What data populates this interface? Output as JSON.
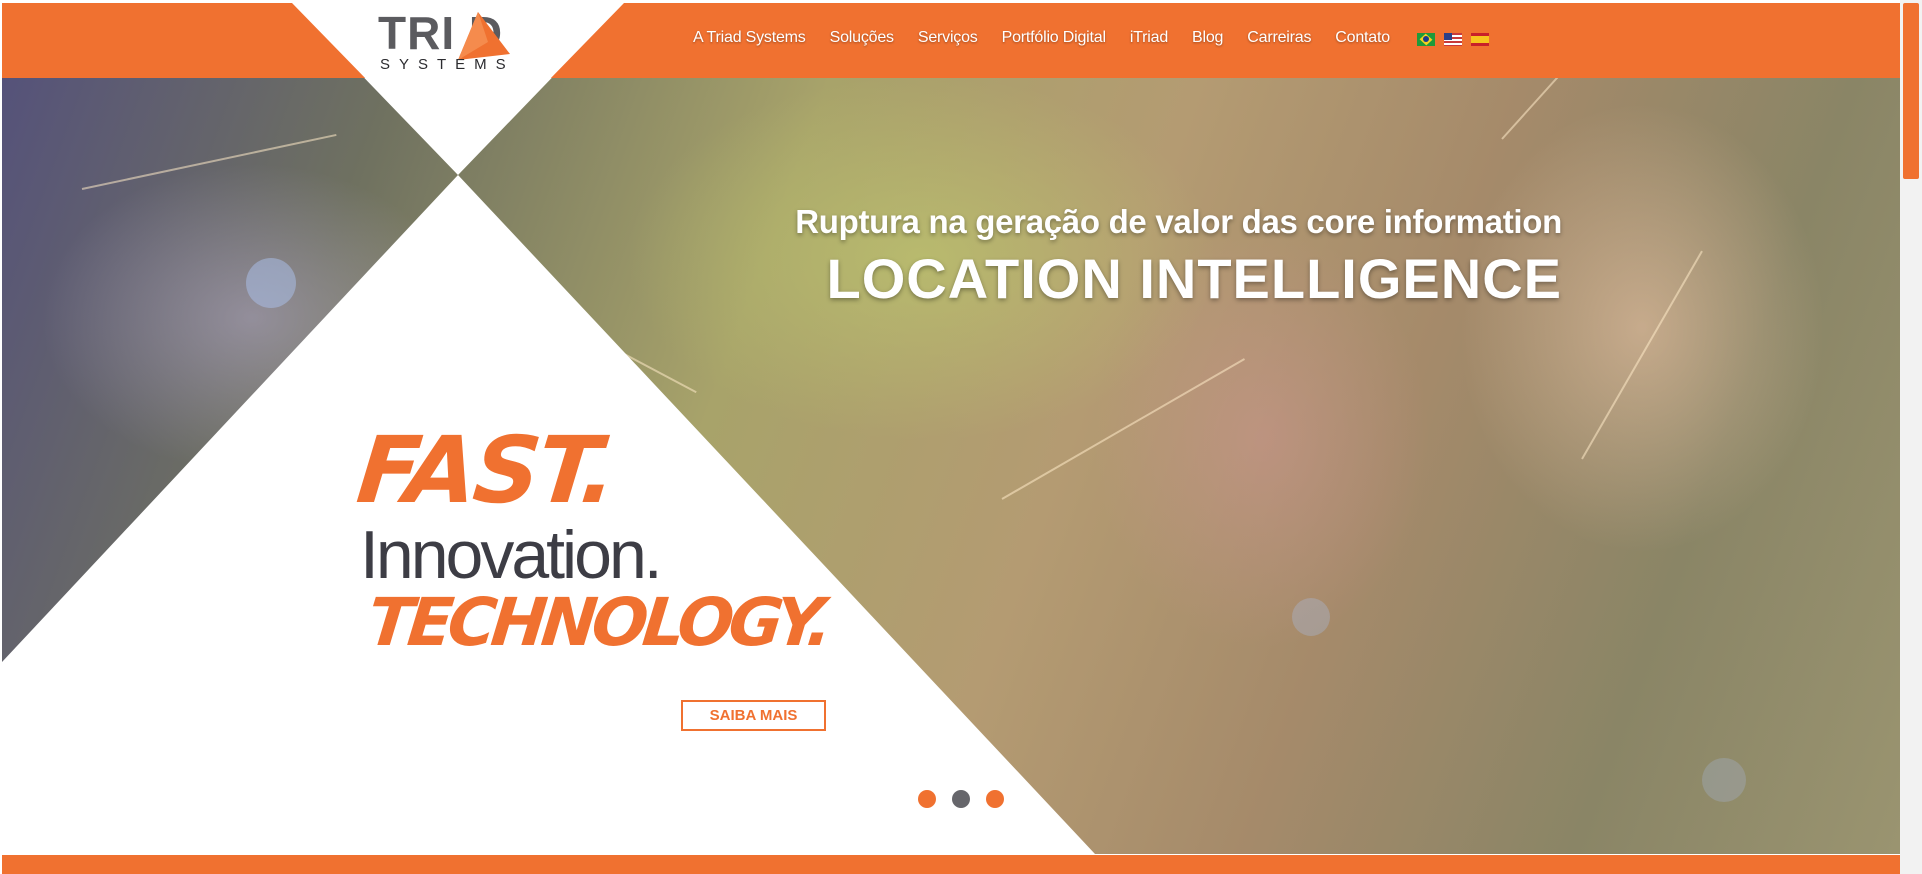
{
  "logo": {
    "word": "TRI D",
    "sub": "SYSTEMS",
    "icon": "triad-triangle-logo"
  },
  "nav": {
    "items": [
      "A Triad Systems",
      "Soluções",
      "Serviços",
      "Portfólio Digital",
      "iTriad",
      "Blog",
      "Carreiras",
      "Contato"
    ],
    "languages": [
      {
        "name": "brazil-flag-icon"
      },
      {
        "name": "usa-flag-icon"
      },
      {
        "name": "spain-flag-icon"
      }
    ]
  },
  "hero": {
    "subtitle": "Ruptura na geração de valor das core information",
    "title": "LOCATION INTELLIGENCE",
    "tagline_fast": "FAST.",
    "tagline_innovation": "Innovation.",
    "tagline_technology": "TECHNOLOGY.",
    "cta_label": "SAIBA MAIS"
  },
  "carousel": {
    "slides": 3,
    "active_index": 1,
    "dot_colors": [
      "#f07130",
      "#66666b",
      "#f07130"
    ]
  },
  "colors": {
    "accent": "#f07130",
    "text_dark": "#3d3d45",
    "white": "#ffffff"
  }
}
